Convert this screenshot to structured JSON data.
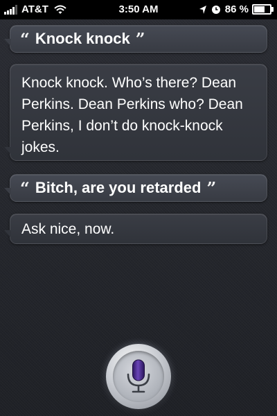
{
  "status_bar": {
    "carrier": "AT&T",
    "time": "3:50 AM",
    "battery_percent": "86 %",
    "battery_level": 0.86
  },
  "conversation": [
    {
      "speaker": "user",
      "text": "Knock knock"
    },
    {
      "speaker": "siri",
      "text": "Knock knock. Who’s there? Dean Perkins. Dean Perkins who? Dean Perkins, I don’t do knock-knock jokes."
    },
    {
      "speaker": "user",
      "text": "Bitch, are you retarded"
    },
    {
      "speaker": "siri",
      "text": "Ask nice, now."
    }
  ],
  "quotes": {
    "open": "“",
    "close": "”"
  },
  "colors": {
    "accent_mic": "#4b2a8e",
    "background": "#24262c"
  },
  "icons": [
    "signal-bars-icon",
    "wifi-icon",
    "location-arrow-icon",
    "alarm-clock-icon",
    "battery-icon",
    "microphone-icon"
  ]
}
